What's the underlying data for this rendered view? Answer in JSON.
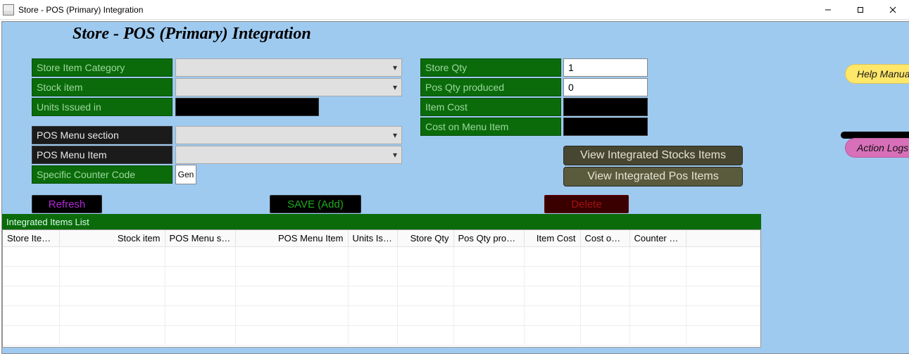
{
  "window": {
    "title": "Store - POS (Primary) Integration"
  },
  "page_title": "Store - POS (Primary) Integration",
  "labels": {
    "store_item_category": "Store Item Category",
    "stock_item": "Stock item",
    "units_issued_in": "Units Issued in",
    "pos_menu_section": "POS Menu section",
    "pos_menu_item": "POS Menu Item",
    "specific_counter_code": "Specific Counter Code",
    "store_qty": "Store Qty",
    "pos_qty_produced": "Pos Qty produced",
    "item_cost": "Item Cost",
    "cost_on_menu_item": "Cost on Menu Item"
  },
  "values": {
    "units_issued_in": "",
    "item_cost": "",
    "cost_on_menu_item": ""
  },
  "inputs": {
    "store_qty": "1",
    "pos_qty_produced": "0",
    "counter_code_btn": "Gen"
  },
  "combos": {
    "store_item_category": "",
    "stock_item": "",
    "pos_menu_section": "",
    "pos_menu_item": ""
  },
  "buttons": {
    "refresh": "Refresh",
    "save": "SAVE (Add)",
    "delete": "Delete",
    "view_stock": "View Integrated Stocks Items",
    "view_pos": "View Integrated Pos Items",
    "help_manual": "Help Manua",
    "action_logs": "Action Logs"
  },
  "list": {
    "header": "Integrated Items List",
    "columns": [
      "Store Ite…",
      "Stock item",
      "POS Menu se…",
      "POS Menu Item",
      "Units Issu…",
      "Store Qty",
      "Pos Qty pro…",
      "Item Cost",
      "Cost on …",
      "Counter …"
    ],
    "rows": []
  }
}
